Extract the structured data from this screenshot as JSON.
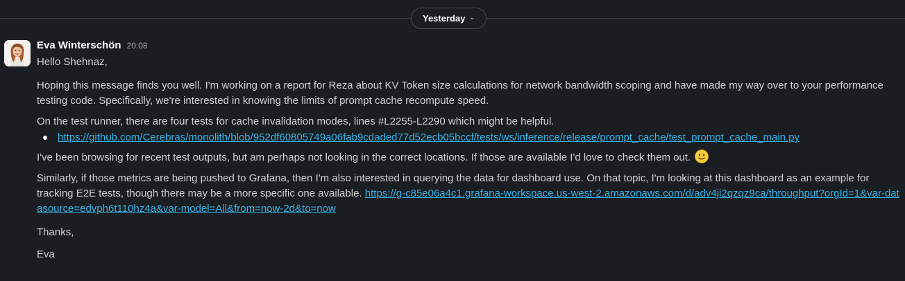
{
  "divider": {
    "date_label": "Yesterday"
  },
  "message": {
    "sender": "Eva Winterschön",
    "time": "20:08",
    "greeting": "Hello Shehnaz,",
    "para1": "Hoping this message finds you well. I'm working on a report for Reza about KV Token size calculations for network bandwidth scoping and have made my way over to your performance testing code. Specifically, we're interested in knowing the limits of prompt cache recompute speed.",
    "para2": "On the test runner, there are four tests for cache invalidation modes, lines #L2255-L2290 which might be helpful.",
    "link1": "https://github.com/Cerebras/monolith/blob/952df60805749a06fab9cdaded77d52ecb05bccf/tests/ws/inference/release/prompt_cache/test_prompt_cache_main.py",
    "para3": "I've been browsing for recent test outputs, but am perhaps not looking in the correct locations. If those are available I'd love to check them out.",
    "para4": "Similarly, if those metrics are being pushed to Grafana, then I'm also interested in querying the data for dashboard use. On that topic, I'm looking at this dashboard as an example for tracking E2E tests, though there may be a more specific one available.",
    "link2": "https://g-c85e06a4c1.grafana-workspace.us-west-2.amazonaws.com/d/adv4ji2qzqz9ca/throughput?orgId=1&var-datasource=edvph6t110hz4a&var-model=All&from=now-2d&to=now",
    "thanks": "Thanks,",
    "signoff": "Eva"
  },
  "icons": {
    "emoji": "slightly-smiling-face-icon",
    "chevron": "chevron-down-icon"
  },
  "colors": {
    "background": "#1a1d21",
    "text": "#d1d2d3",
    "link": "#36b3e8",
    "sender": "#ffffff"
  }
}
